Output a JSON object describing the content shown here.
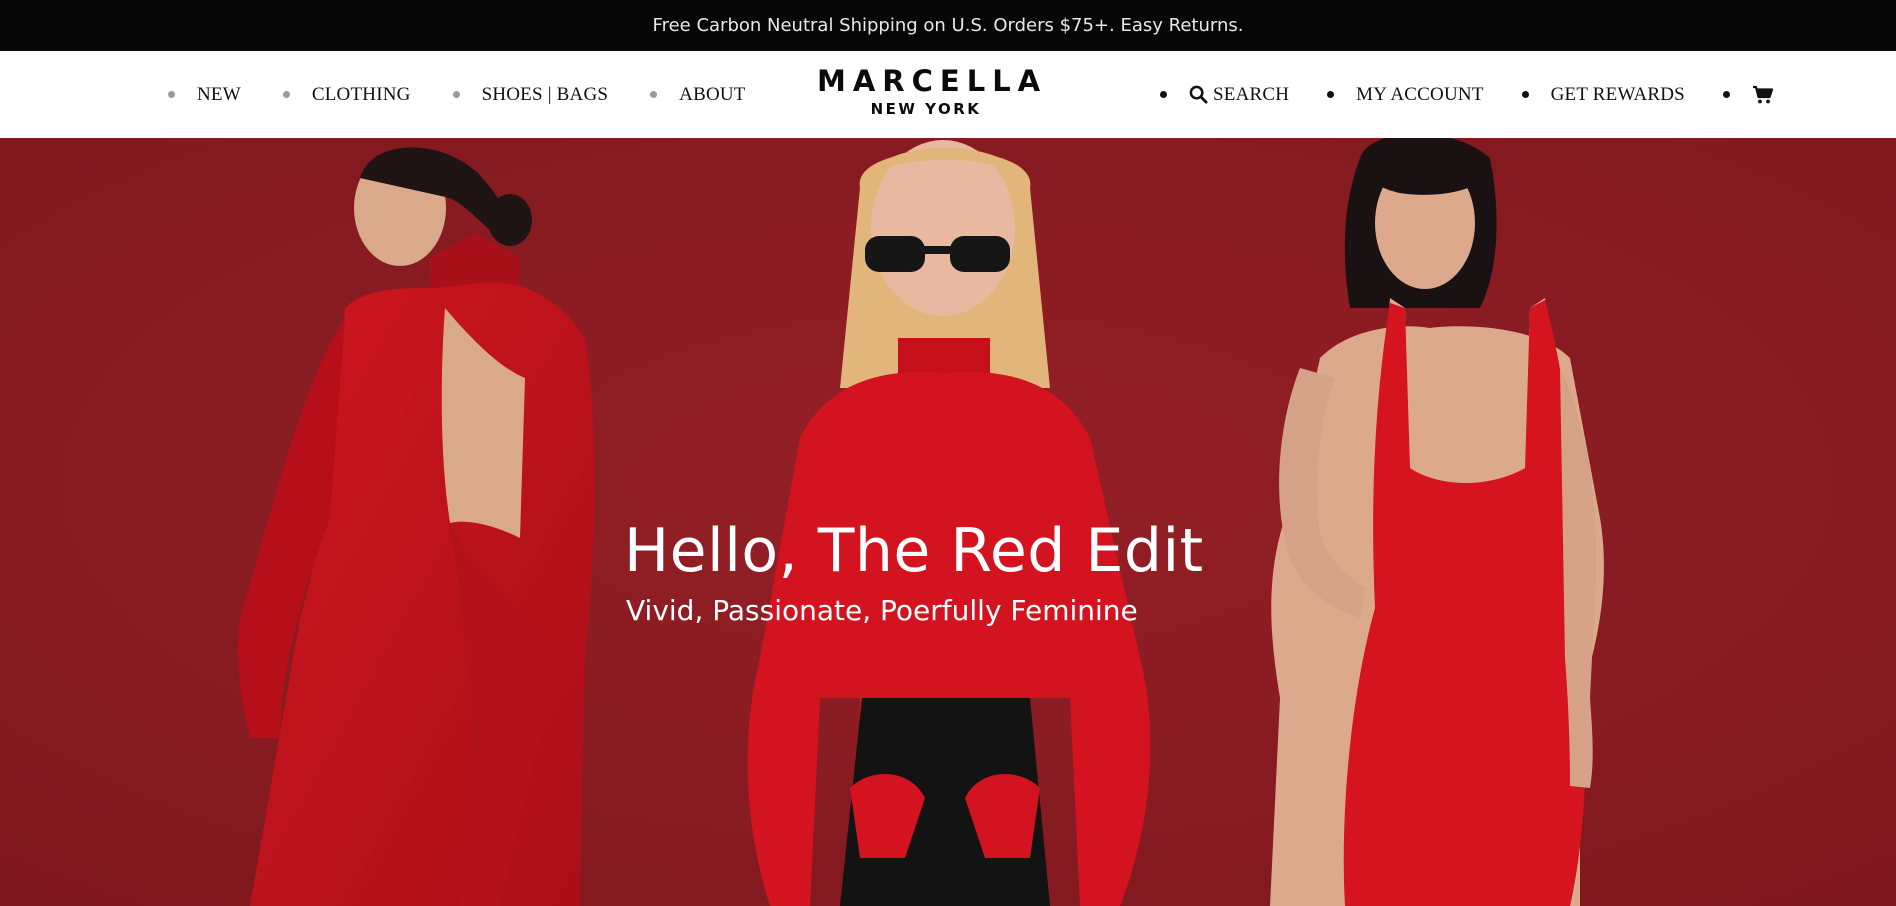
{
  "announcement": {
    "text": "Free Carbon Neutral Shipping on U.S. Orders $75+. Easy Returns."
  },
  "nav_left": {
    "items": [
      {
        "label": "NEW"
      },
      {
        "label": "CLOTHING"
      },
      {
        "label": "SHOES | BAGS"
      },
      {
        "label": "ABOUT"
      }
    ]
  },
  "logo": {
    "main": "MARCELLA",
    "sub": "NEW YORK"
  },
  "nav_right": {
    "search": {
      "label": "SEARCH",
      "icon": "search-icon"
    },
    "account": {
      "label": "MY ACCOUNT"
    },
    "rewards": {
      "label": "GET REWARDS"
    },
    "cart": {
      "icon": "cart-icon"
    }
  },
  "hero": {
    "title": "Hello, The Red Edit",
    "subtitle": "Vivid, Passionate, Poerfully Feminine",
    "background_color": "#8a1c22",
    "garment_color": "#c8141f"
  }
}
